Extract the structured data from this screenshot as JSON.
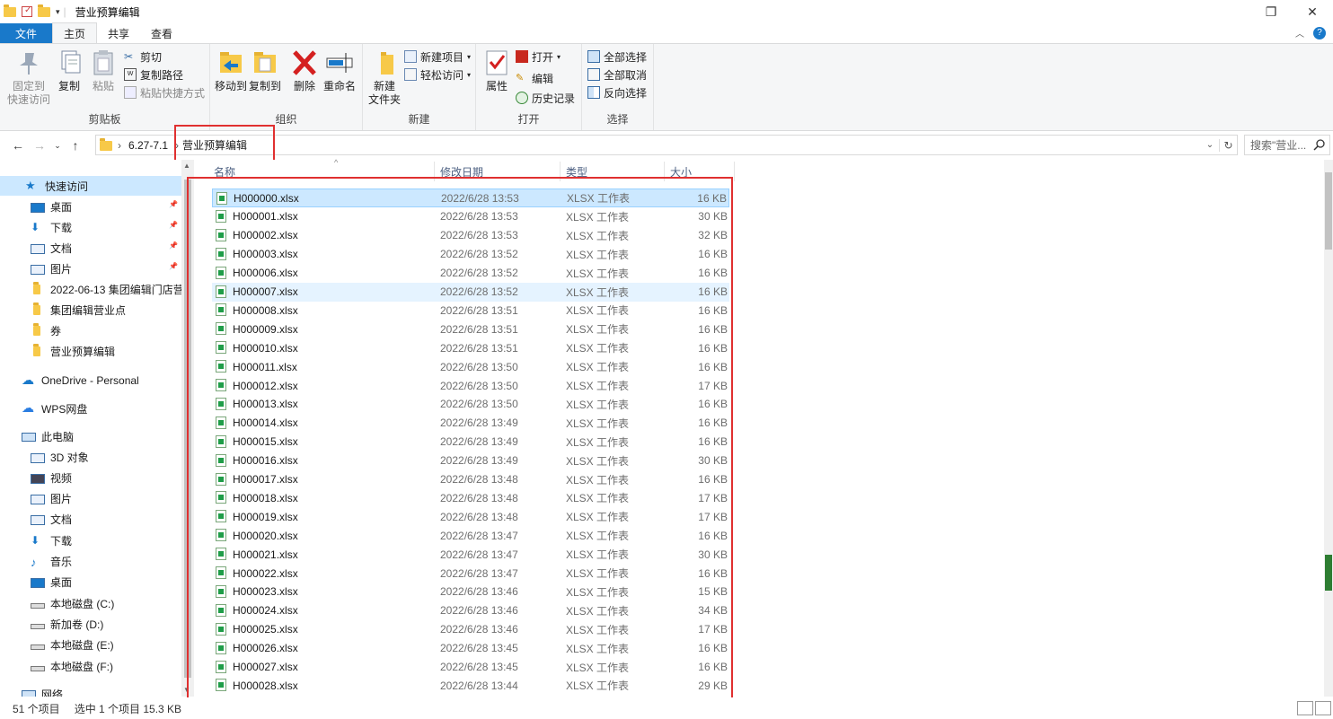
{
  "window": {
    "title": "营业预算编辑",
    "controls": {
      "maximize_glyph": "❐",
      "close_glyph": "✕"
    }
  },
  "tabs": {
    "file": "文件",
    "home": "主页",
    "share": "共享",
    "view": "查看"
  },
  "ribbon": {
    "clipboard": {
      "label": "剪贴板",
      "pin": "固定到\n快速访问",
      "copy": "复制",
      "paste": "粘贴",
      "cut": "剪切",
      "copy_path": "复制路径",
      "paste_shortcut": "粘贴快捷方式"
    },
    "organize": {
      "label": "组织",
      "move_to": "移动到",
      "copy_to": "复制到",
      "delete": "删除",
      "rename": "重命名"
    },
    "new": {
      "label": "新建",
      "new_folder": "新建\n文件夹",
      "new_item": "新建项目",
      "easy_access": "轻松访问"
    },
    "open": {
      "label": "打开",
      "properties": "属性",
      "open": "打开",
      "edit": "编辑",
      "history": "历史记录"
    },
    "select": {
      "label": "选择",
      "select_all": "全部选择",
      "select_none": "全部取消",
      "invert": "反向选择"
    }
  },
  "address": {
    "segments": [
      "6.27-7.1",
      "营业预算编辑"
    ],
    "search_placeholder": "搜索\"营业..."
  },
  "nav": {
    "quick_access": "快速访问",
    "items": [
      {
        "label": "桌面",
        "pinned": true
      },
      {
        "label": "下载",
        "pinned": true
      },
      {
        "label": "文档",
        "pinned": true
      },
      {
        "label": "图片",
        "pinned": true
      },
      {
        "label": "2022-06-13 集团编辑门店营",
        "pinned": false
      },
      {
        "label": "集团编辑营业点",
        "pinned": false
      },
      {
        "label": "券",
        "pinned": false
      },
      {
        "label": "营业预算编辑",
        "pinned": false
      }
    ],
    "onedrive": "OneDrive - Personal",
    "wps": "WPS网盘",
    "this_pc": "此电脑",
    "pc_items": [
      "3D 对象",
      "视频",
      "图片",
      "文档",
      "下载",
      "音乐",
      "桌面",
      "本地磁盘 (C:)",
      "新加卷 (D:)",
      "本地磁盘 (E:)",
      "本地磁盘 (F:)"
    ],
    "network": "网络"
  },
  "columns": {
    "name": "名称",
    "date": "修改日期",
    "type": "类型",
    "size": "大小"
  },
  "files": [
    {
      "name": "H000000.xlsx",
      "date": "2022/6/28 13:53",
      "type": "XLSX 工作表",
      "size": "16 KB"
    },
    {
      "name": "H000001.xlsx",
      "date": "2022/6/28 13:53",
      "type": "XLSX 工作表",
      "size": "30 KB"
    },
    {
      "name": "H000002.xlsx",
      "date": "2022/6/28 13:53",
      "type": "XLSX 工作表",
      "size": "32 KB"
    },
    {
      "name": "H000003.xlsx",
      "date": "2022/6/28 13:52",
      "type": "XLSX 工作表",
      "size": "16 KB"
    },
    {
      "name": "H000006.xlsx",
      "date": "2022/6/28 13:52",
      "type": "XLSX 工作表",
      "size": "16 KB"
    },
    {
      "name": "H000007.xlsx",
      "date": "2022/6/28 13:52",
      "type": "XLSX 工作表",
      "size": "16 KB"
    },
    {
      "name": "H000008.xlsx",
      "date": "2022/6/28 13:51",
      "type": "XLSX 工作表",
      "size": "16 KB"
    },
    {
      "name": "H000009.xlsx",
      "date": "2022/6/28 13:51",
      "type": "XLSX 工作表",
      "size": "16 KB"
    },
    {
      "name": "H000010.xlsx",
      "date": "2022/6/28 13:51",
      "type": "XLSX 工作表",
      "size": "16 KB"
    },
    {
      "name": "H000011.xlsx",
      "date": "2022/6/28 13:50",
      "type": "XLSX 工作表",
      "size": "16 KB"
    },
    {
      "name": "H000012.xlsx",
      "date": "2022/6/28 13:50",
      "type": "XLSX 工作表",
      "size": "17 KB"
    },
    {
      "name": "H000013.xlsx",
      "date": "2022/6/28 13:50",
      "type": "XLSX 工作表",
      "size": "16 KB"
    },
    {
      "name": "H000014.xlsx",
      "date": "2022/6/28 13:49",
      "type": "XLSX 工作表",
      "size": "16 KB"
    },
    {
      "name": "H000015.xlsx",
      "date": "2022/6/28 13:49",
      "type": "XLSX 工作表",
      "size": "16 KB"
    },
    {
      "name": "H000016.xlsx",
      "date": "2022/6/28 13:49",
      "type": "XLSX 工作表",
      "size": "30 KB"
    },
    {
      "name": "H000017.xlsx",
      "date": "2022/6/28 13:48",
      "type": "XLSX 工作表",
      "size": "16 KB"
    },
    {
      "name": "H000018.xlsx",
      "date": "2022/6/28 13:48",
      "type": "XLSX 工作表",
      "size": "17 KB"
    },
    {
      "name": "H000019.xlsx",
      "date": "2022/6/28 13:48",
      "type": "XLSX 工作表",
      "size": "17 KB"
    },
    {
      "name": "H000020.xlsx",
      "date": "2022/6/28 13:47",
      "type": "XLSX 工作表",
      "size": "16 KB"
    },
    {
      "name": "H000021.xlsx",
      "date": "2022/6/28 13:47",
      "type": "XLSX 工作表",
      "size": "30 KB"
    },
    {
      "name": "H000022.xlsx",
      "date": "2022/6/28 13:47",
      "type": "XLSX 工作表",
      "size": "16 KB"
    },
    {
      "name": "H000023.xlsx",
      "date": "2022/6/28 13:46",
      "type": "XLSX 工作表",
      "size": "15 KB"
    },
    {
      "name": "H000024.xlsx",
      "date": "2022/6/28 13:46",
      "type": "XLSX 工作表",
      "size": "34 KB"
    },
    {
      "name": "H000025.xlsx",
      "date": "2022/6/28 13:46",
      "type": "XLSX 工作表",
      "size": "17 KB"
    },
    {
      "name": "H000026.xlsx",
      "date": "2022/6/28 13:45",
      "type": "XLSX 工作表",
      "size": "16 KB"
    },
    {
      "name": "H000027.xlsx",
      "date": "2022/6/28 13:45",
      "type": "XLSX 工作表",
      "size": "16 KB"
    },
    {
      "name": "H000028.xlsx",
      "date": "2022/6/28 13:44",
      "type": "XLSX 工作表",
      "size": "29 KB"
    }
  ],
  "selected_index": 0,
  "hover_index": 5,
  "status": {
    "count": "51 个项目",
    "selected": "选中 1 个项目  15.3 KB"
  },
  "colors": {
    "file_tab": "#1979ca",
    "selection": "#cce8ff",
    "annotation": "#e03030"
  }
}
